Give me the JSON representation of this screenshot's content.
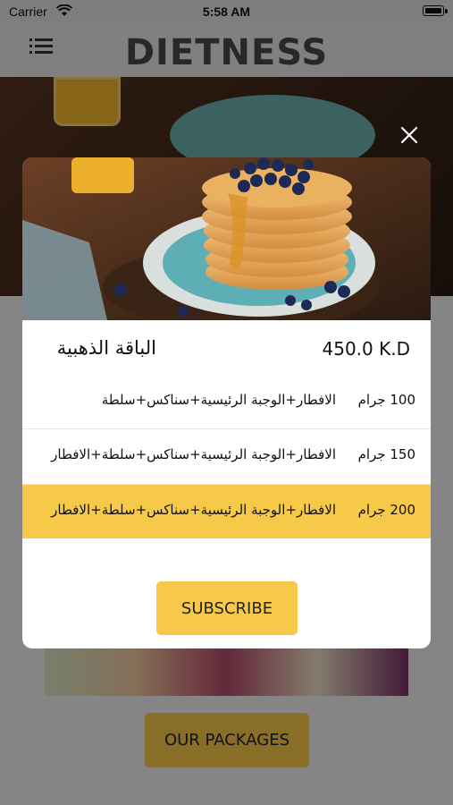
{
  "status_bar": {
    "carrier": "Carrier",
    "time": "5:58 AM",
    "icons": [
      "wifi-icon",
      "battery-icon"
    ]
  },
  "header": {
    "logo_text": "DIETNESS",
    "menu_icon": "hamburger-menu-icon"
  },
  "modal": {
    "close_icon": "close-icon",
    "image": "pancakes-with-blueberries",
    "package_name": "الباقة الذهبية",
    "price": "450.0 K.D",
    "options": [
      {
        "grams": "100 جرام",
        "description": "الافطار+الوجبة الرئيسية+سناكس+سلطة",
        "selected": false
      },
      {
        "grams": "150 جرام",
        "description": "الافطار+الوجبة الرئيسية+سناكس+سلطة+الافطار",
        "selected": false
      },
      {
        "grams": "200 جرام",
        "description": "الافطار+الوجبة الرئيسية+سناكس+سلطة+الافطار",
        "selected": true
      }
    ],
    "subscribe_label": "SUBSCRIBE"
  },
  "footer": {
    "packages_label": "OUR PACKAGES"
  },
  "colors": {
    "accent": "#f7c948",
    "overlay": "rgba(0,0,0,0.45)",
    "text": "#111111"
  }
}
